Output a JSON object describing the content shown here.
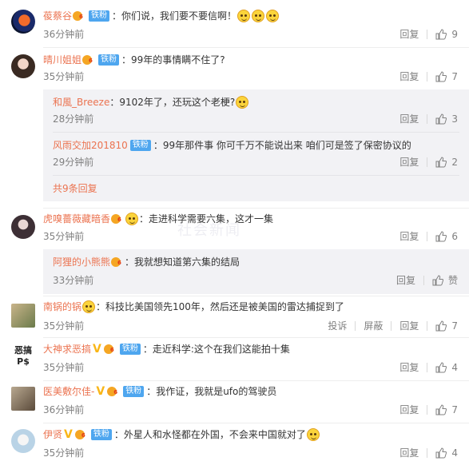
{
  "comments": [
    {
      "user": "葰蔡谷",
      "vip": "6",
      "badge": "铁粉",
      "text": "：你们说，我们要不要信啊！",
      "emojis": 3,
      "time": "36分钟前",
      "reply": "回复",
      "likes": "9",
      "avatar_color": "#1a2a4a"
    },
    {
      "user": "晴川姐姐",
      "vip": "6",
      "badge": "铁粉",
      "text": "：99年的事情瞒不住了?",
      "time": "35分钟前",
      "reply": "回复",
      "likes": "7",
      "avatar_color": "#c8a89a",
      "replies": [
        {
          "user": "和風_Breeze",
          "text": "：9102年了，还玩这个老梗?",
          "time": "28分钟前",
          "reply": "回复",
          "likes": "3"
        },
        {
          "user": "风雨交加201810",
          "badge": "铁粉",
          "text": "：99年那件事 你可千万不能说出来  咱们可是签了保密协议的",
          "time": "29分钟前",
          "reply": "回复",
          "likes": "2"
        }
      ],
      "more": "共9条回复"
    },
    {
      "user": "虎嗅薔薇藏暗香",
      "vip": "6",
      "text": "：走进科学需要六集，这才一集",
      "time": "35分钟前",
      "reply": "回复",
      "likes": "6",
      "avatar_color": "#6b5a6a",
      "replies": [
        {
          "user": "阿狸的小熊熊",
          "vip": "6",
          "text": "：我就想知道第六集的结局",
          "time": "33分钟前",
          "reply": "回复",
          "likes": "赞"
        }
      ]
    },
    {
      "user": "南锅的锅",
      "vip": "6",
      "text": "：科技比美国领先100年，然后还是被美国的雷达捕捉到了",
      "time": "35分钟前",
      "report": "投诉",
      "block": "屏蔽",
      "reply": "回复",
      "likes": "7",
      "avatar_color": "#7a8a5a"
    },
    {
      "user": "大神求恶搞",
      "vip": "6",
      "badge": "铁粉",
      "text": "：走近科学:这个在我们这能拍十集",
      "time": "35分钟前",
      "reply": "回复",
      "likes": "4",
      "avatar_text_top": "恶搞",
      "avatar_text_bottom": "P$"
    },
    {
      "user": "医美敷尔佳-",
      "vip": "6",
      "badge": "铁粉",
      "text": "：我作证，我就是ufo的驾驶员",
      "time": "36分钟前",
      "reply": "回复",
      "likes": "7",
      "avatar_color": "#8a7a6a"
    },
    {
      "user": "伊贤",
      "vip": "6",
      "badge": "铁粉",
      "text": "：外星人和水怪都在外国，不会来中国就对了",
      "time": "35分钟前",
      "reply": "回复",
      "likes": "4",
      "avatar_color": "#cfe0ee"
    }
  ],
  "watermark": "社会新闻"
}
